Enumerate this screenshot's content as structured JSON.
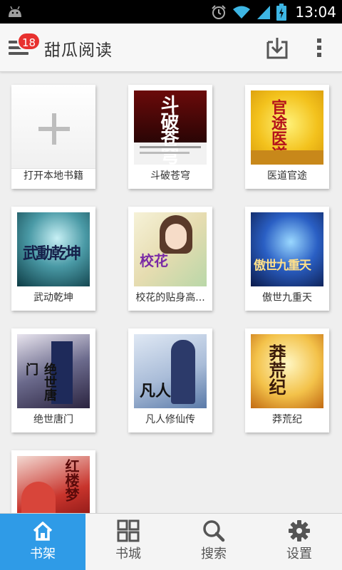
{
  "status_bar": {
    "time": "13:04"
  },
  "header": {
    "menu_badge": "18",
    "title": "甜瓜阅读"
  },
  "shelf": {
    "items": [
      {
        "label": "打开本地书籍"
      },
      {
        "label": "斗破苍穹",
        "cover_text": "斗破苍穹"
      },
      {
        "label": "医道官途",
        "cover_text": "官途医道"
      },
      {
        "label": "武动乾坤",
        "cover_text": "武動乾坤"
      },
      {
        "label": "校花的贴身高...",
        "cover_text": "校花"
      },
      {
        "label": "傲世九重天",
        "cover_text": "傲世九重天"
      },
      {
        "label": "绝世唐门",
        "cover_text": "绝世唐门"
      },
      {
        "label": "凡人修仙传",
        "cover_text": "凡人"
      },
      {
        "label": "莽荒纪",
        "cover_text": "莽荒纪"
      },
      {
        "label": "",
        "cover_text": "红楼梦"
      }
    ]
  },
  "bottom_nav": {
    "tabs": [
      {
        "label": "书架",
        "icon": "home-icon",
        "active": true
      },
      {
        "label": "书城",
        "icon": "grid-icon",
        "active": false
      },
      {
        "label": "搜索",
        "icon": "search-icon",
        "active": false
      },
      {
        "label": "设置",
        "icon": "gear-icon",
        "active": false
      }
    ]
  },
  "colors": {
    "accent": "#2f9be7",
    "badge": "#e8312f"
  }
}
